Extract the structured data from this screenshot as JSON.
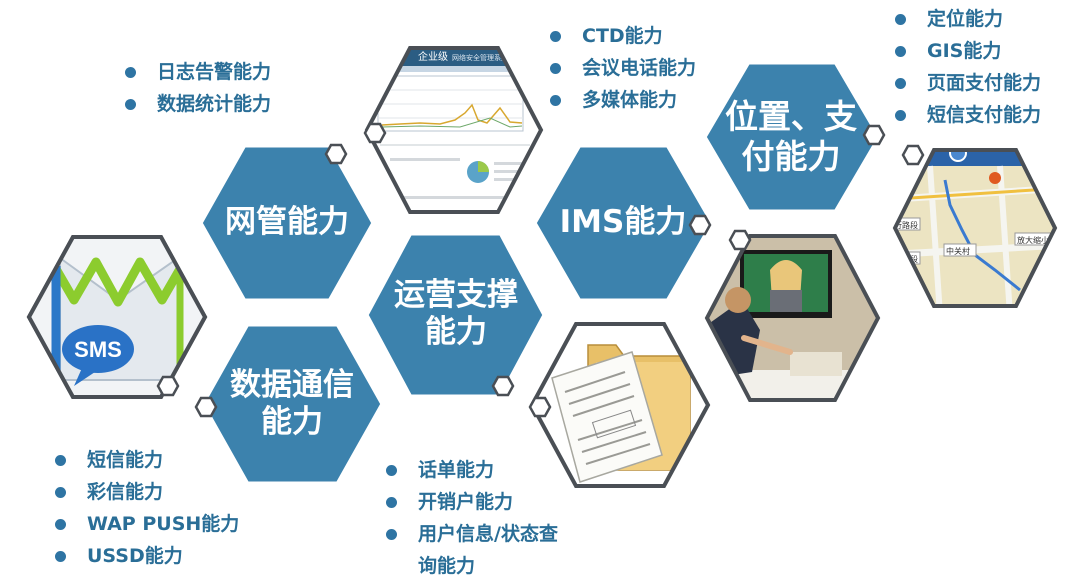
{
  "hexes": {
    "netmgmt": "网管能力",
    "ims": "IMS能力",
    "location": "位置、支付能力",
    "ops": "运营支撑能力",
    "datacomm": "数据通信能力"
  },
  "images": {
    "sms_badge": "SMS",
    "screenshot_title": "企业级",
    "map_labels": [
      "步行路段",
      "车站路段",
      "中关村",
      "放大缩小"
    ]
  },
  "lists": {
    "netmgmt": [
      "日志告警能力",
      "数据统计能力"
    ],
    "ims": [
      "CTD能力",
      "会议电话能力",
      "多媒体能力"
    ],
    "location": [
      "定位能力",
      "GIS能力",
      "页面支付能力",
      "短信支付能力"
    ],
    "datacomm": [
      "短信能力",
      "彩信能力",
      "WAP PUSH能力",
      "USSD能力"
    ],
    "ops": [
      "话单能力",
      "开销户能力",
      "用户信息/状态查",
      "询能力"
    ]
  },
  "colors": {
    "hex_fill": "#3c82ad",
    "outline": "#4a4f55",
    "bullet": "#2e74a3",
    "list_text": "#2a6e97"
  }
}
